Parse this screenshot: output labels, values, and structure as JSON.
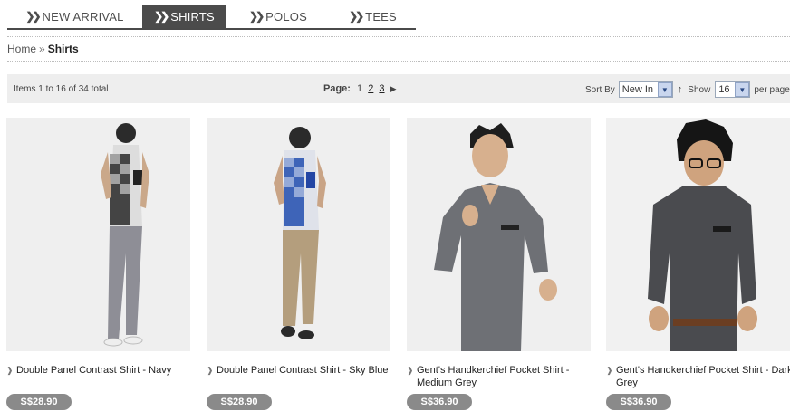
{
  "nav": {
    "items": [
      {
        "label": "NEW ARRIVAL",
        "active": false
      },
      {
        "label": "SHIRTS",
        "active": true
      },
      {
        "label": "POLOS",
        "active": false
      },
      {
        "label": "TEES",
        "active": false
      }
    ]
  },
  "breadcrumb": {
    "home": "Home",
    "separator": "»",
    "current": "Shirts"
  },
  "toolbar": {
    "items_text": "Items 1 to 16 of 34 total",
    "page_label": "Page:",
    "pages": [
      "1",
      "2",
      "3"
    ],
    "current_page": "1",
    "sort_label": "Sort By",
    "sort_value": "New In",
    "show_label": "Show",
    "show_value": "16",
    "per_page_label": "per page"
  },
  "products": [
    {
      "name": "Double Panel Contrast Shirt - Navy",
      "price": "S$28.90"
    },
    {
      "name": "Double Panel Contrast Shirt - Sky Blue",
      "price": "S$28.90"
    },
    {
      "name": "Gent's Handkerchief Pocket Shirt - Medium Grey",
      "price": "S$36.90"
    },
    {
      "name": "Gent's Handkerchief Pocket Shirt - Dark Grey",
      "price": "S$36.90"
    }
  ],
  "icons": {
    "nav_chevron": "double-chevron-icon",
    "pager_next": "triangle-right-icon",
    "sort_direction": "arrow-up-icon",
    "item_bullet": "bullet-icon"
  }
}
